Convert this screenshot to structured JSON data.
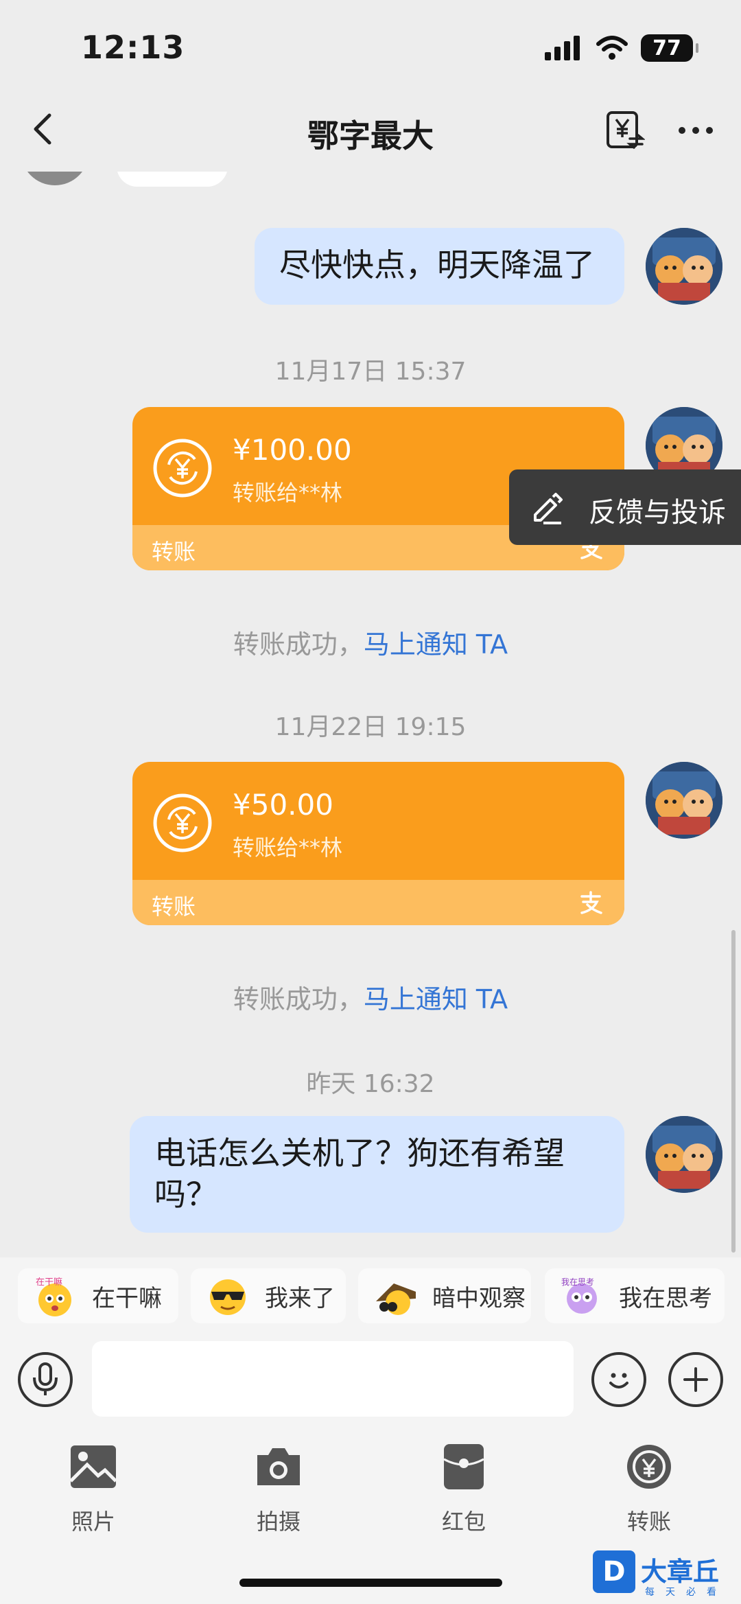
{
  "status_bar": {
    "time": "12:13",
    "battery": "77"
  },
  "nav": {
    "title": "鄂字最大"
  },
  "messages": {
    "m1": "尽快快点，明天降温了",
    "ts1": "11月17日 15:37",
    "transfer1": {
      "amount": "¥100.00",
      "to": "转账给**林",
      "label": "转账"
    },
    "sys1": {
      "text": "转账成功，",
      "link": "马上通知 TA"
    },
    "ts2": "11月22日 19:15",
    "transfer2": {
      "amount": "¥50.00",
      "to": "转账给**林",
      "label": "转账"
    },
    "sys2": {
      "text": "转账成功，",
      "link": "马上通知 TA"
    },
    "ts3": "昨天 16:32",
    "m2": "电话怎么关机了？狗还有希望吗？"
  },
  "feedback": {
    "label": "反馈与投诉"
  },
  "quick_replies": [
    {
      "icon": "在干嘛",
      "label": "在干嘛"
    },
    {
      "icon": "sunglasses-emoji",
      "label": "我来了"
    },
    {
      "icon": "peek-emoji",
      "label": "暗中观察"
    },
    {
      "icon": "我在思考",
      "label": "我在思考"
    }
  ],
  "input": {
    "placeholder": ""
  },
  "toolbar": {
    "items": [
      {
        "label": "照片",
        "icon": "photo-icon"
      },
      {
        "label": "拍摄",
        "icon": "camera-icon"
      },
      {
        "label": "红包",
        "icon": "red-packet-icon"
      },
      {
        "label": "转账",
        "icon": "transfer-icon"
      }
    ]
  },
  "watermark": {
    "badge": "D",
    "title": "大章丘",
    "subtitle": "每天必看"
  },
  "colors": {
    "transfer": "#fa9d1c",
    "link": "#3475d5",
    "bubble": "#d6e6ff"
  }
}
